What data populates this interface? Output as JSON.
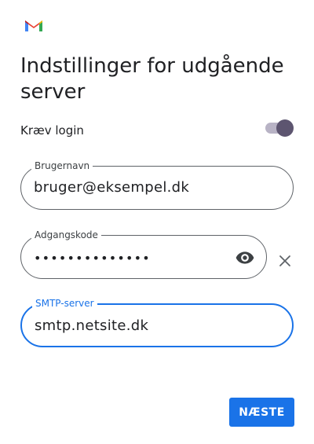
{
  "header": {
    "logo_icon": "gmail-logo-icon",
    "title": "Indstillinger for udgående server"
  },
  "require_login": {
    "label": "Kræv login",
    "enabled": true
  },
  "username": {
    "label": "Brugernavn",
    "value": "bruger@eksempel.dk"
  },
  "password": {
    "label": "Adgangskode",
    "value": "••••••••••••••",
    "toggle_icon": "eye-icon",
    "clear_icon": "close-icon"
  },
  "smtp": {
    "label": "SMTP-server",
    "value": "smtp.netsite.dk"
  },
  "actions": {
    "next_label": "NÆSTE"
  },
  "colors": {
    "accent": "#1a73e8",
    "switch_thumb": "#5d5570",
    "switch_track": "#b8b3c5"
  }
}
